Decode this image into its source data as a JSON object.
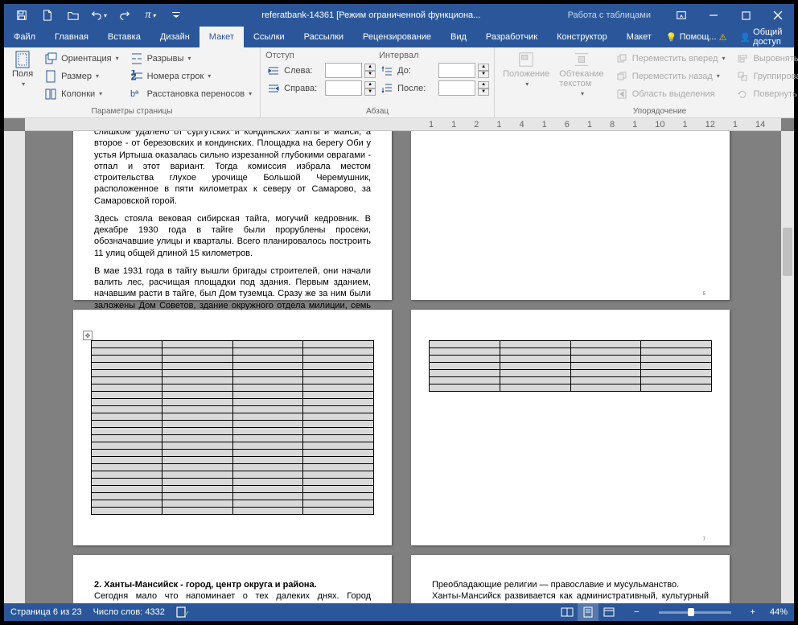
{
  "title": "referatbank-14361 [Режим ограниченной функциона...",
  "context_tab": "Работа с таблицами",
  "menu": {
    "file": "Файл",
    "home": "Главная",
    "insert": "Вставка",
    "design": "Дизайн",
    "layout": "Макет",
    "references": "Ссылки",
    "mailings": "Рассылки",
    "review": "Рецензирование",
    "view": "Вид",
    "developer": "Разработчик",
    "constructor": "Конструктор",
    "layout2": "Макет",
    "help": "Помощ...",
    "share": "Общий доступ"
  },
  "ribbon": {
    "page_setup": {
      "margins": "Поля",
      "orientation": "Ориентация",
      "size": "Размер",
      "columns": "Колонки",
      "breaks": "Разрывы",
      "line_numbers": "Номера строк",
      "hyphenation": "Расстановка переносов",
      "label": "Параметры страницы"
    },
    "paragraph": {
      "indent_title": "Отступ",
      "left": "Слева:",
      "right": "Справа:",
      "spacing_title": "Интервал",
      "before": "До:",
      "after": "После:",
      "label": "Абзац"
    },
    "arrange": {
      "position": "Положение",
      "wrap": "Обтекание текстом",
      "forward": "Переместить вперед",
      "backward": "Переместить назад",
      "selection": "Область выделения",
      "align": "Выровнять",
      "group": "Группировать",
      "rotate": "Повернуть",
      "label": "Упорядочение"
    }
  },
  "status": {
    "page": "Страница 6 из 23",
    "words": "Число слов: 4332",
    "zoom": "44%"
  },
  "doc": {
    "p1": "слишком удалено от сургутских и кондинских ханты и манси, а второе - от березовских и кондинских. Площадка на берегу Оби у устья Иртыша оказалась сильно изрезанной глубокими оврагами - отпал и этот вариант. Тогда комиссия избрала местом строительства глухое урочище Большой Черемушник, расположенное в пяти километрах к северу от Самарово, за Самаровской горой.",
    "p2": "Здесь стояла вековая сибирская тайга, могучий кедровник. В декабре 1930 года в тайге были прорублены просеки, обозначавшие улицы и кварталы. Всего планировалось построить 11 улиц общей длиной 15 километров.",
    "p3": "В мае 1931 года в тайгу вышли бригады строителей, они начали валить лес, расчищая площадки под здания. Первым зданием, начавшим расти в тайге, был Дом туземца. Сразу же за ним были заложены Дом Советов, здание окружного отдела милиции, семь жилых домов.",
    "h2": "2. Ханты-Мансийск - город, центр округа и района.",
    "p4": "Сегодня мало что напоминает о тех далеких днях. Город развивается быстрыми темпами и формируется не только как центр нефтяного",
    "p5": "Преобладающие религии — православие и мусульманство.",
    "p6": "Ханты-Мансийск развивается как административный, культурный и финансовый центр округа."
  }
}
